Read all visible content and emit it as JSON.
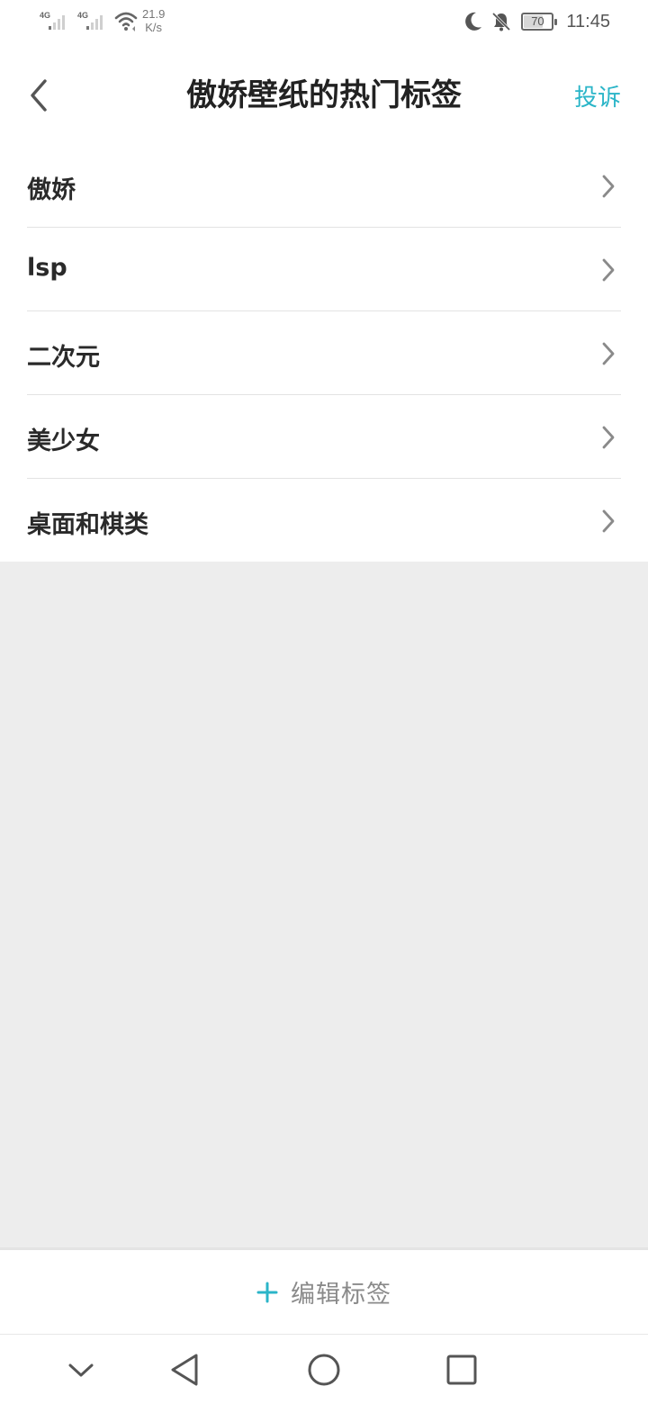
{
  "status_bar": {
    "net_type_1": "4G",
    "net_type_2": "4G",
    "speed_value": "21.9",
    "speed_unit": "K/s",
    "battery_level": "70",
    "battery_fraction": 0.7,
    "time": "11:45",
    "icons": [
      "signal-icon",
      "signal-icon",
      "wifi-icon",
      "moon-icon",
      "bell-muted-icon",
      "battery-icon"
    ]
  },
  "header": {
    "title": "傲娇壁纸的热门标签",
    "report_label": "投诉",
    "back_icon": "chevron-left-icon"
  },
  "tags": [
    {
      "label": "傲娇"
    },
    {
      "label": "lsp"
    },
    {
      "label": "二次元"
    },
    {
      "label": "美少女"
    },
    {
      "label": "桌面和棋类"
    }
  ],
  "edit_bar": {
    "label": "编辑标签",
    "icon": "plus-icon"
  },
  "nav_bar": {
    "icons": [
      "chevron-down-icon",
      "back-triangle-icon",
      "home-circle-icon",
      "recents-square-icon"
    ]
  },
  "colors": {
    "accent": "#2bb5c8",
    "background": "#ededed",
    "surface": "#ffffff",
    "text_primary": "#222222",
    "text_muted": "#8a8a8a"
  }
}
